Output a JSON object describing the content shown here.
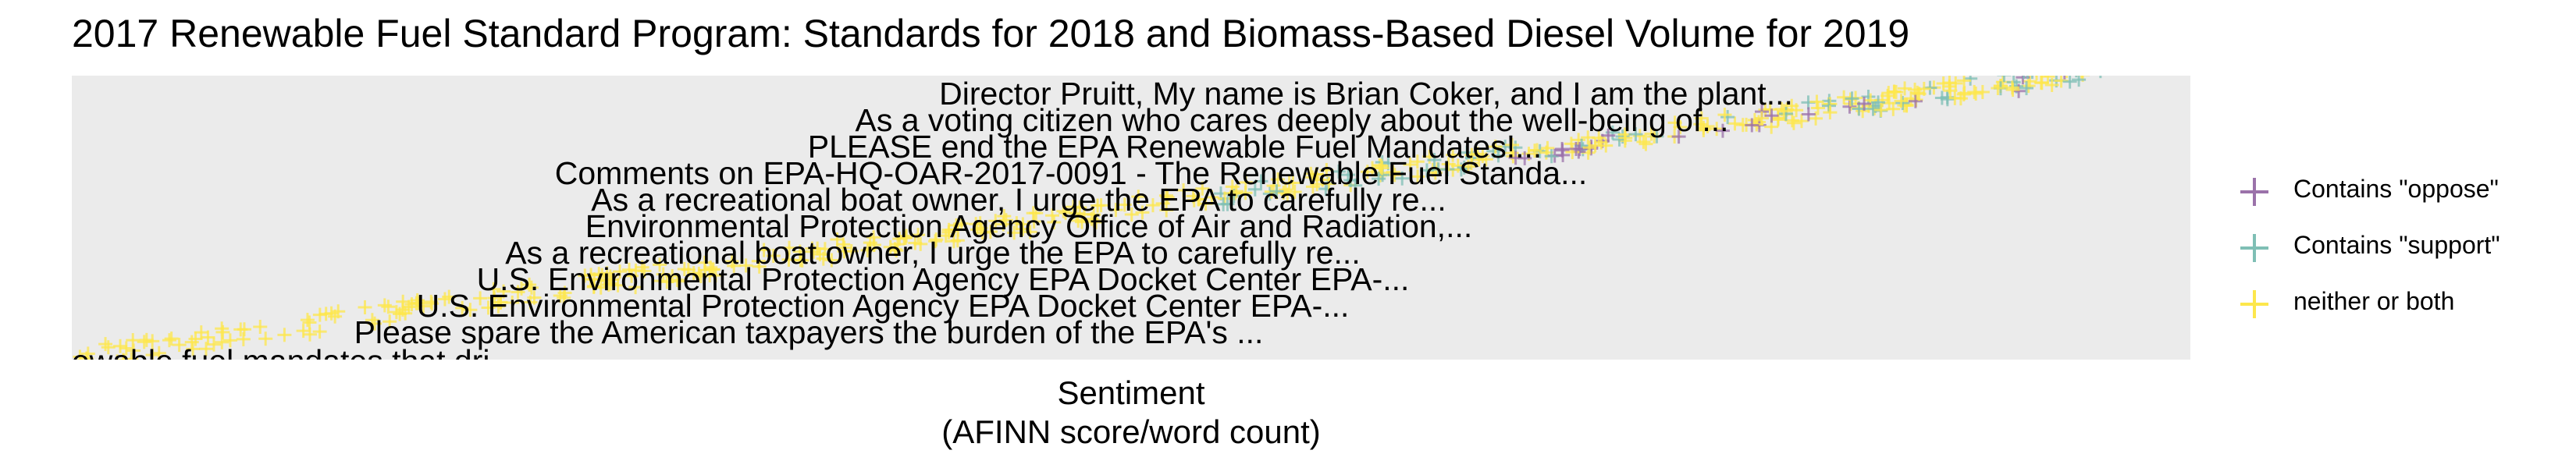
{
  "title": "2017 Renewable Fuel Standard Program: Standards for 2018 and Biomass-Based Diesel Volume for 2019",
  "colors": {
    "panel_bg": "#ebebeb",
    "oppose": "#9b72aa",
    "support": "#7fbfb5",
    "neither": "#fde74c"
  },
  "chart_data": {
    "type": "scatter",
    "title": "2017 Renewable Fuel Standard Program: Standards for 2018 and Biomass-Based Diesel Volume for 2019",
    "xlabel": "Sentiment\n(AFINN score/word count)",
    "ylabel": "",
    "grid": false,
    "legend_position": "right",
    "series": [
      {
        "name": "Contains \"oppose\"",
        "marker": "plus",
        "color": "#9b72aa"
      },
      {
        "name": "Contains \"support\"",
        "marker": "plus",
        "color": "#7fbfb5"
      },
      {
        "name": "neither or both",
        "marker": "plus",
        "color": "#fde74c"
      }
    ],
    "annotations": [
      "Director Pruitt,  My name is Brian Coker, and I am the plant...",
      "As a voting citizen who cares deeply about the well-being of...",
      "PLEASE end the EPA Renewable Fuel Mandates!...",
      "Comments on EPA-HQ-OAR-2017-0091 - The Renewable Fuel Standa...",
      "As a recreational boat owner, I urge the EPA to carefully re...",
      "Environmental Protection Agency Office of Air and Radiation,...",
      "As a recreational boat owner, I urge the EPA to carefully re...",
      "U.S. Environmental Protection Agency EPA Docket Center  EPA-...",
      "U.S. Environmental Protection Agency EPA Docket Center  EPA-...",
      "Please spare the American taxpayers the burden of the EPA's ...",
      "o renewable fuel mandates that dri..."
    ]
  }
}
